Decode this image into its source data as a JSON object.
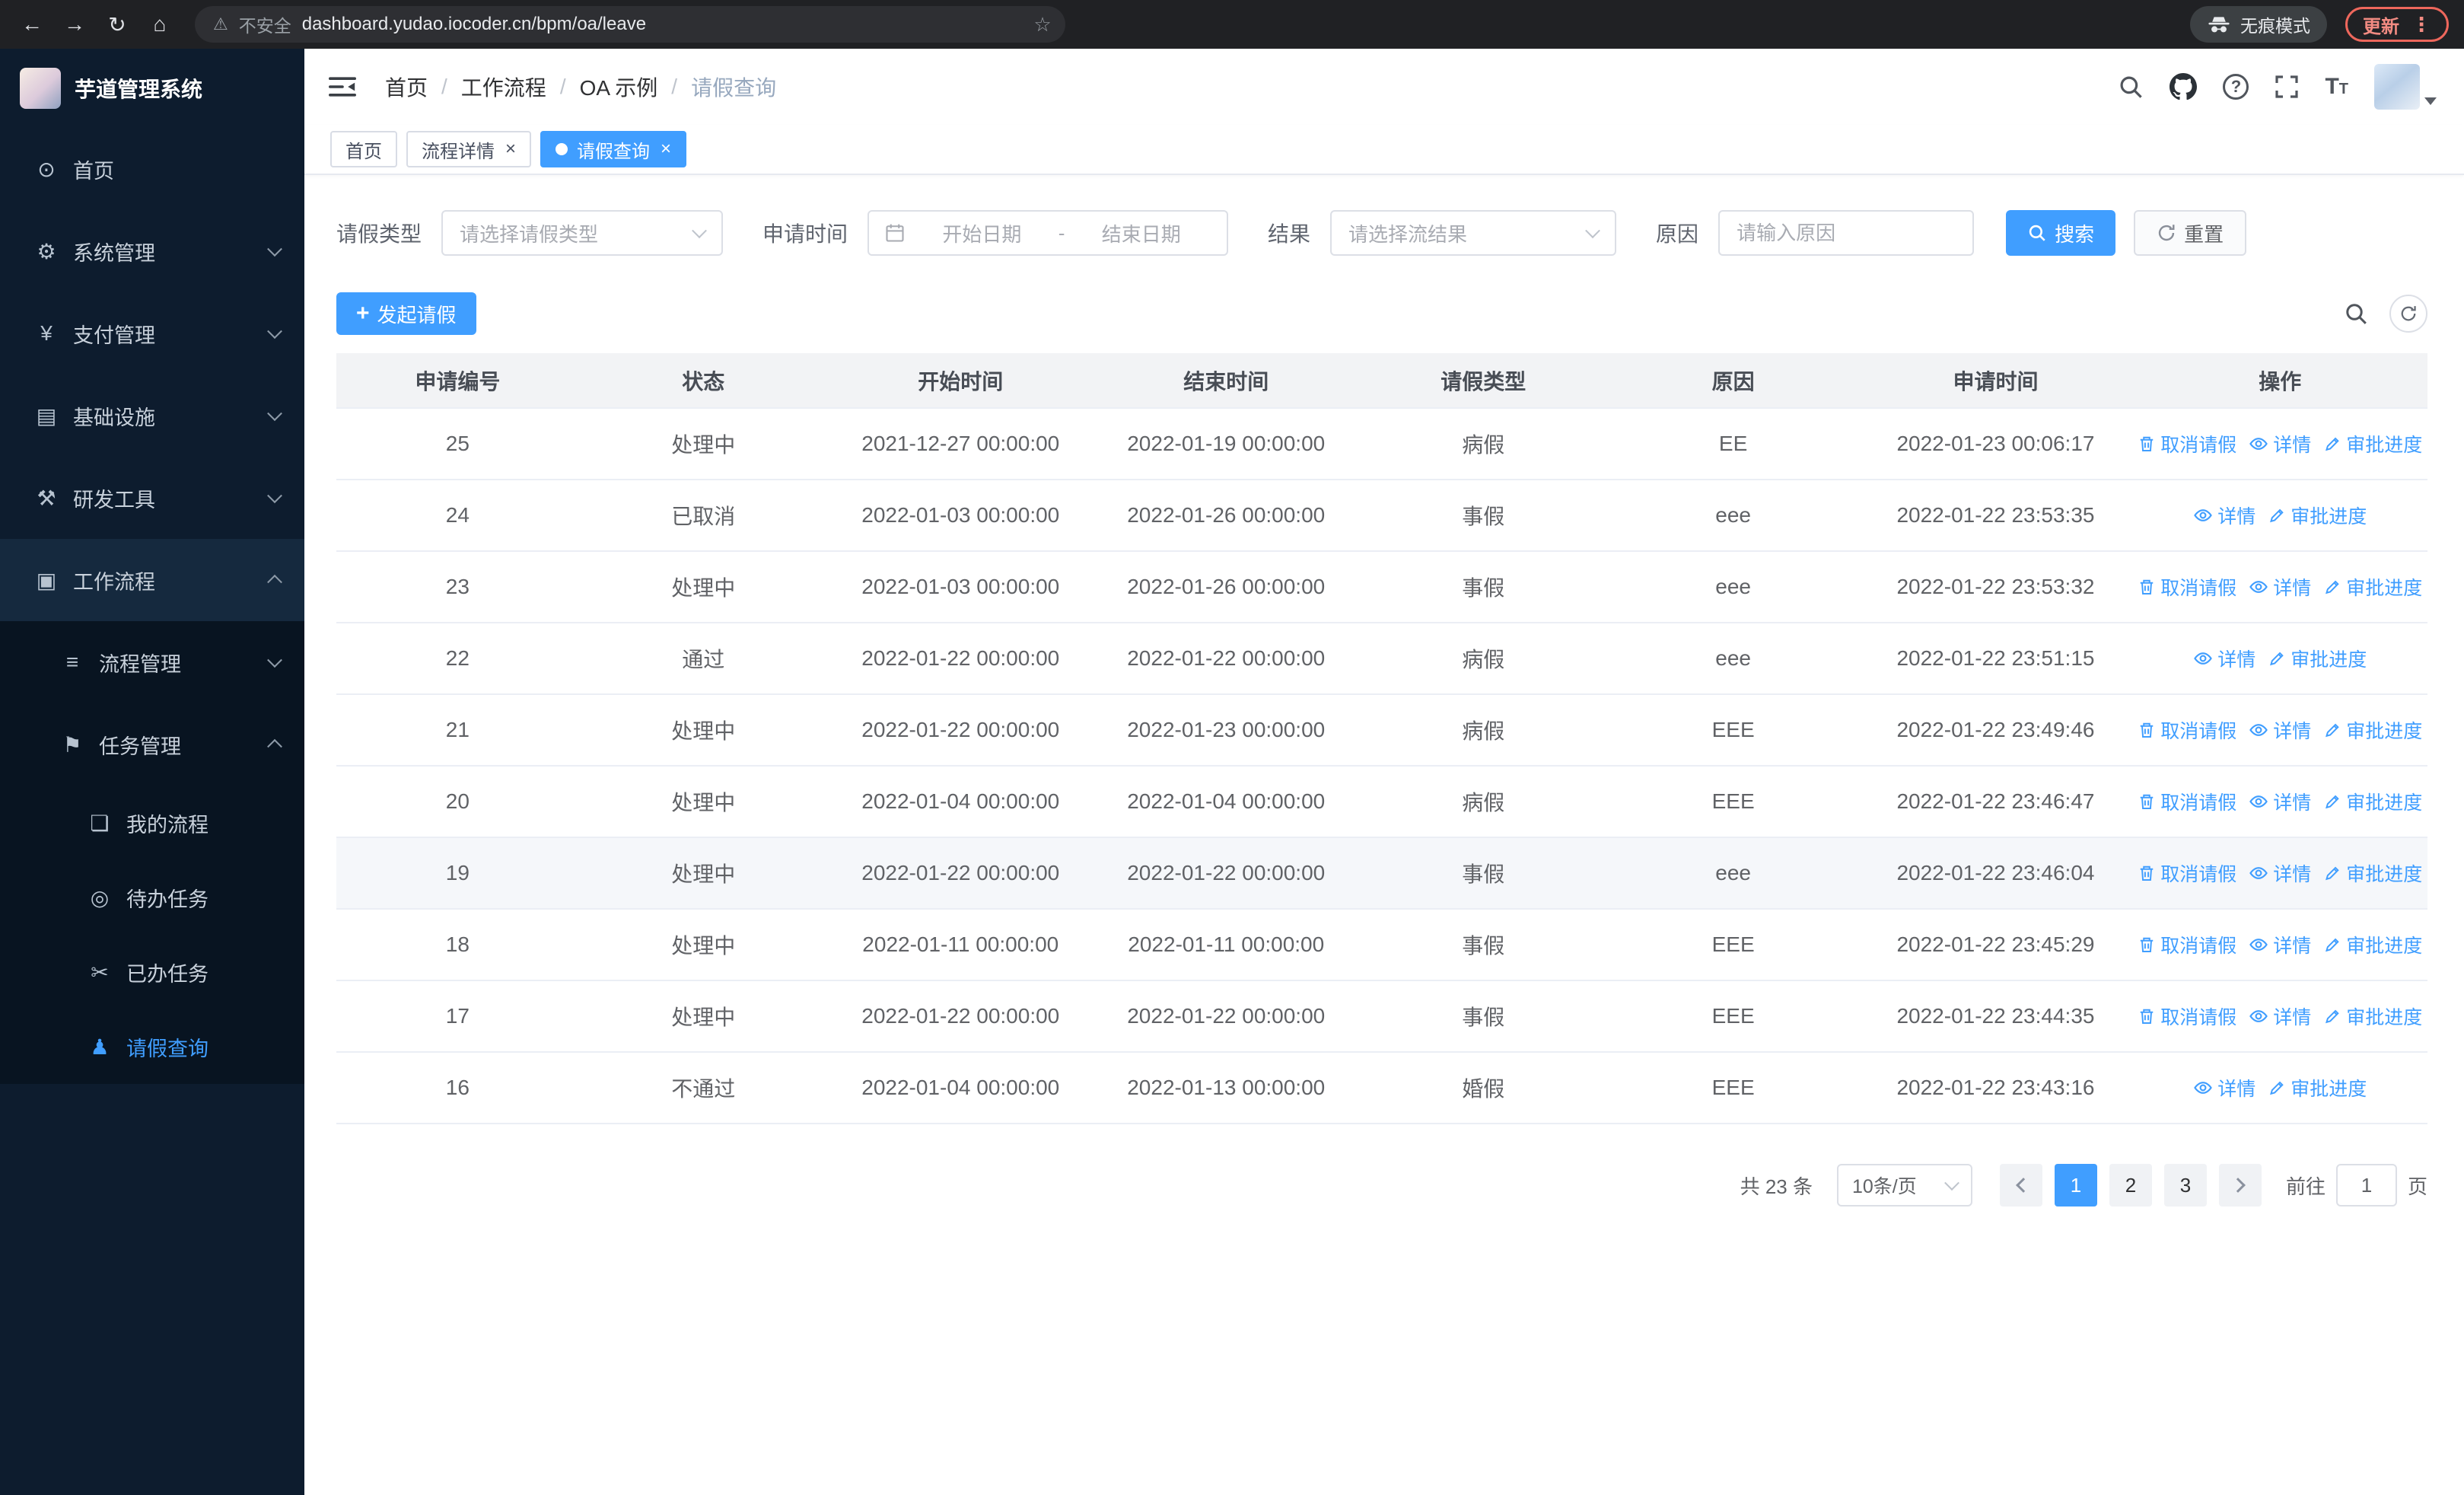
{
  "browser": {
    "security_warning": "不安全",
    "url": "dashboard.yudao.iocoder.cn/bpm/oa/leave",
    "incognito_label": "无痕模式",
    "update_button": "更新"
  },
  "sidebar": {
    "logo_title": "芋道管理系统",
    "items": [
      {
        "label": "首页",
        "icon": "dashboard-icon",
        "level": 0
      },
      {
        "label": "系统管理",
        "icon": "gear-icon",
        "level": 0,
        "arrow": "down"
      },
      {
        "label": "支付管理",
        "icon": "yen-icon",
        "level": 0,
        "arrow": "down"
      },
      {
        "label": "基础设施",
        "icon": "infrastructure-icon",
        "level": 0,
        "arrow": "down"
      },
      {
        "label": "研发工具",
        "icon": "tools-icon",
        "level": 0,
        "arrow": "down"
      },
      {
        "label": "工作流程",
        "icon": "workflow-icon",
        "level": 0,
        "arrow": "up",
        "open": true
      },
      {
        "label": "流程管理",
        "icon": "process-icon",
        "level": 1,
        "arrow": "down",
        "submenu": true
      },
      {
        "label": "任务管理",
        "icon": "task-icon",
        "level": 1,
        "arrow": "up",
        "submenu": true
      },
      {
        "label": "我的流程",
        "icon": "my-process-icon",
        "level": 2,
        "submenu": true
      },
      {
        "label": "待办任务",
        "icon": "todo-task-icon",
        "level": 2,
        "submenu": true
      },
      {
        "label": "已办任务",
        "icon": "done-task-icon",
        "level": 2,
        "submenu": true
      },
      {
        "label": "请假查询",
        "icon": "user-icon",
        "level": 2,
        "submenu": true,
        "active": true
      }
    ]
  },
  "header": {
    "breadcrumb": [
      "首页",
      "工作流程",
      "OA 示例",
      "请假查询"
    ]
  },
  "tabs": [
    {
      "label": "首页"
    },
    {
      "label": "流程详情",
      "closable": true
    },
    {
      "label": "请假查询",
      "closable": true,
      "active": true
    }
  ],
  "filters": {
    "leave_type_label": "请假类型",
    "leave_type_placeholder": "请选择请假类型",
    "apply_time_label": "申请时间",
    "start_date_placeholder": "开始日期",
    "range_separator": "-",
    "end_date_placeholder": "结束日期",
    "result_label": "结果",
    "result_placeholder": "请选择流结果",
    "reason_label": "原因",
    "reason_placeholder": "请输入原因",
    "search_button": "搜索",
    "reset_button": "重置"
  },
  "toolbar": {
    "create_button": "发起请假"
  },
  "table": {
    "columns": [
      "申请编号",
      "状态",
      "开始时间",
      "结束时间",
      "请假类型",
      "原因",
      "申请时间",
      "操作"
    ],
    "action_labels": {
      "cancel": "取消请假",
      "detail": "详情",
      "progress": "审批进度"
    },
    "rows": [
      {
        "id": "25",
        "status": "处理中",
        "start_time": "2021-12-27 00:00:00",
        "end_time": "2022-01-19 00:00:00",
        "leave_type": "病假",
        "reason": "EE",
        "apply_time": "2022-01-23 00:06:17",
        "actions": [
          "cancel",
          "detail",
          "progress"
        ]
      },
      {
        "id": "24",
        "status": "已取消",
        "start_time": "2022-01-03 00:00:00",
        "end_time": "2022-01-26 00:00:00",
        "leave_type": "事假",
        "reason": "eee",
        "apply_time": "2022-01-22 23:53:35",
        "actions": [
          "detail",
          "progress"
        ]
      },
      {
        "id": "23",
        "status": "处理中",
        "start_time": "2022-01-03 00:00:00",
        "end_time": "2022-01-26 00:00:00",
        "leave_type": "事假",
        "reason": "eee",
        "apply_time": "2022-01-22 23:53:32",
        "actions": [
          "cancel",
          "detail",
          "progress"
        ]
      },
      {
        "id": "22",
        "status": "通过",
        "start_time": "2022-01-22 00:00:00",
        "end_time": "2022-01-22 00:00:00",
        "leave_type": "病假",
        "reason": "eee",
        "apply_time": "2022-01-22 23:51:15",
        "actions": [
          "detail",
          "progress"
        ]
      },
      {
        "id": "21",
        "status": "处理中",
        "start_time": "2022-01-22 00:00:00",
        "end_time": "2022-01-23 00:00:00",
        "leave_type": "病假",
        "reason": "EEE",
        "apply_time": "2022-01-22 23:49:46",
        "actions": [
          "cancel",
          "detail",
          "progress"
        ]
      },
      {
        "id": "20",
        "status": "处理中",
        "start_time": "2022-01-04 00:00:00",
        "end_time": "2022-01-04 00:00:00",
        "leave_type": "病假",
        "reason": "EEE",
        "apply_time": "2022-01-22 23:46:47",
        "actions": [
          "cancel",
          "detail",
          "progress"
        ]
      },
      {
        "id": "19",
        "status": "处理中",
        "start_time": "2022-01-22 00:00:00",
        "end_time": "2022-01-22 00:00:00",
        "leave_type": "事假",
        "reason": "eee",
        "apply_time": "2022-01-22 23:46:04",
        "actions": [
          "cancel",
          "detail",
          "progress"
        ],
        "hovered": true
      },
      {
        "id": "18",
        "status": "处理中",
        "start_time": "2022-01-11 00:00:00",
        "end_time": "2022-01-11 00:00:00",
        "leave_type": "事假",
        "reason": "EEE",
        "apply_time": "2022-01-22 23:45:29",
        "actions": [
          "cancel",
          "detail",
          "progress"
        ]
      },
      {
        "id": "17",
        "status": "处理中",
        "start_time": "2022-01-22 00:00:00",
        "end_time": "2022-01-22 00:00:00",
        "leave_type": "事假",
        "reason": "EEE",
        "apply_time": "2022-01-22 23:44:35",
        "actions": [
          "cancel",
          "detail",
          "progress"
        ]
      },
      {
        "id": "16",
        "status": "不通过",
        "start_time": "2022-01-04 00:00:00",
        "end_time": "2022-01-13 00:00:00",
        "leave_type": "婚假",
        "reason": "EEE",
        "apply_time": "2022-01-22 23:43:16",
        "actions": [
          "detail",
          "progress"
        ]
      }
    ]
  },
  "pagination": {
    "total_text": "共 23 条",
    "page_size": "10条/页",
    "pages": [
      "1",
      "2",
      "3"
    ],
    "active_page": "1",
    "goto_label": "前往",
    "goto_value": "1",
    "goto_suffix": "页"
  }
}
